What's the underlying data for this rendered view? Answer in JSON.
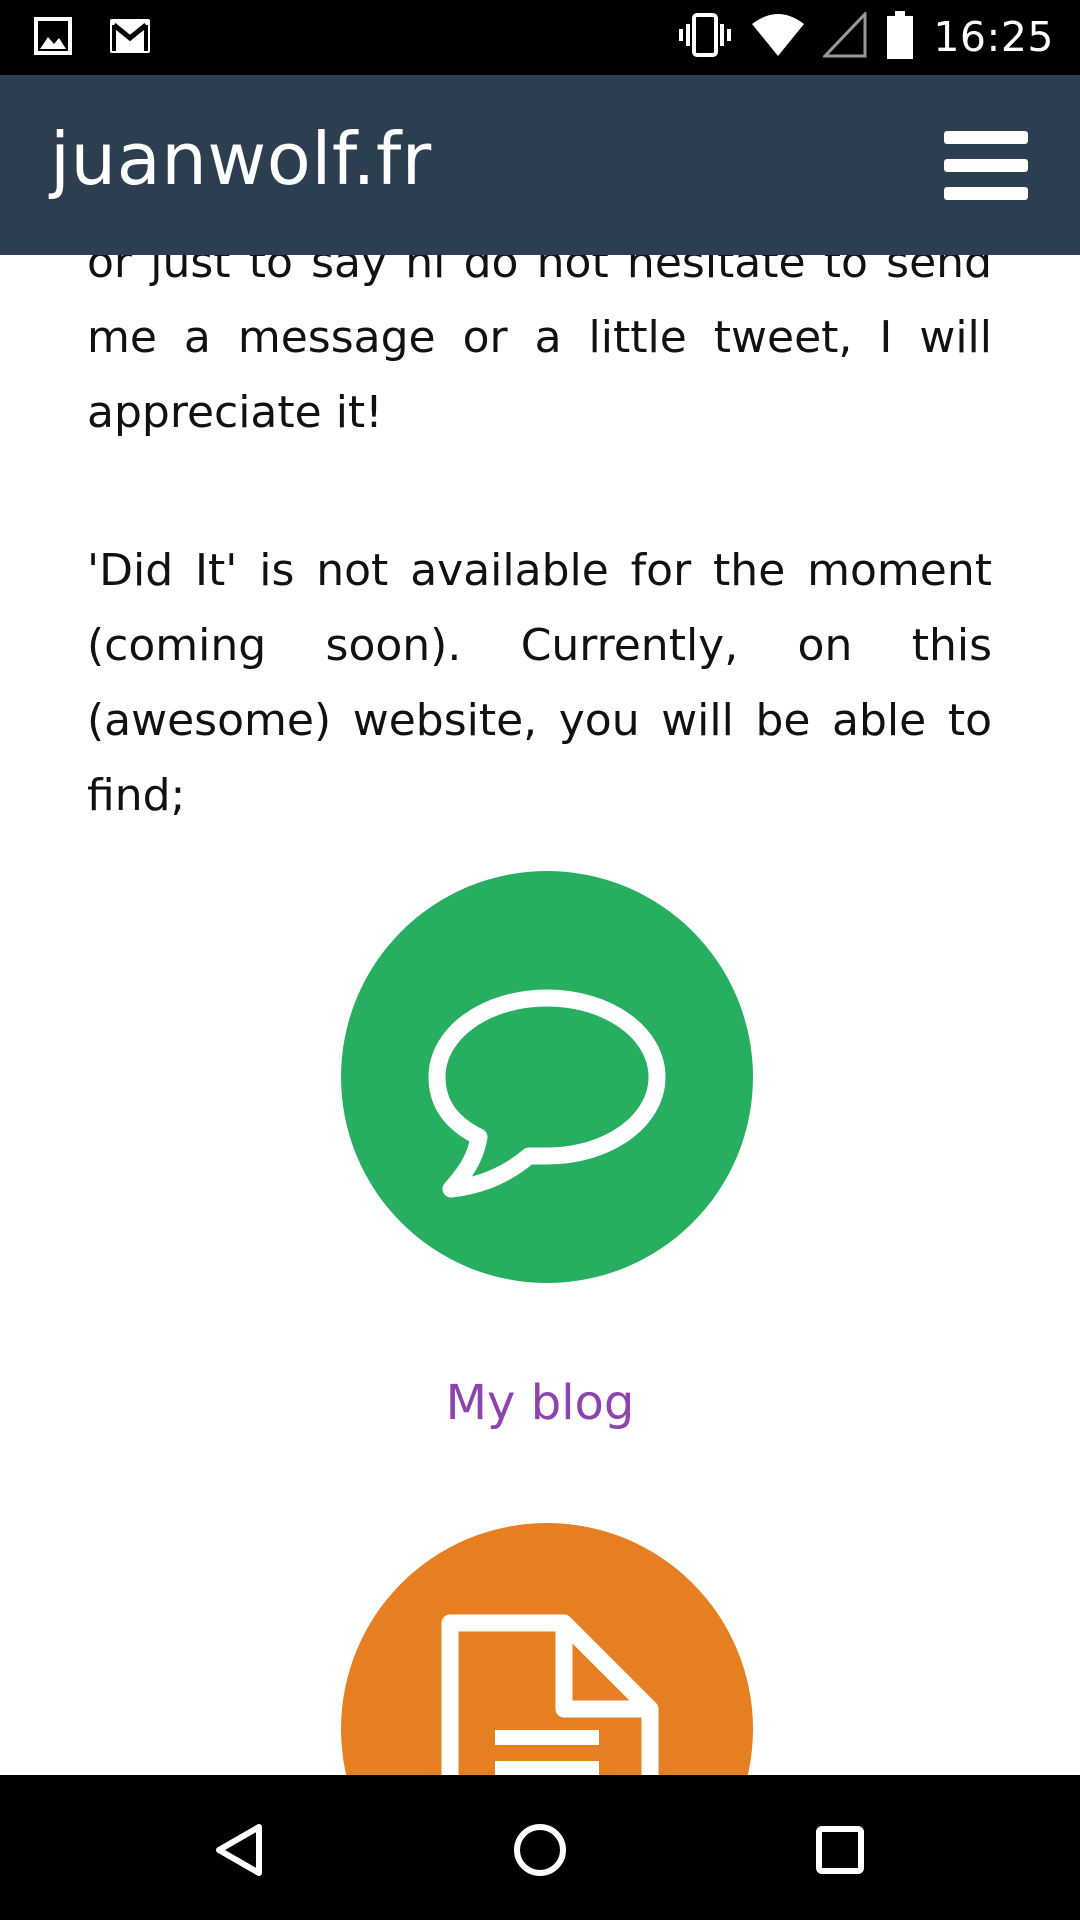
{
  "status_bar": {
    "time": "16:25",
    "left_icons": [
      "image-icon",
      "gmail-icon"
    ],
    "right_icons": [
      "vibrate-icon",
      "wifi-icon",
      "signal-icon",
      "battery-icon"
    ]
  },
  "header": {
    "site_title": "juanwolf.fr",
    "menu_icon": "hamburger-menu-icon",
    "background_color": "#2d3e50"
  },
  "content": {
    "paragraph_1": "or just to say hi do not hesitate to send me a message or a little tweet, I will appreciate it!",
    "paragraph_2": "'Did It' is not available for the moment (coming soon). Currently, on this (awesome) website, you will be able to find;",
    "features": [
      {
        "label": "My blog",
        "icon": "speech-bubble-icon",
        "color": "#27ae60"
      },
      {
        "label": "",
        "icon": "document-icon",
        "color": "#e67e22"
      }
    ],
    "link_color": "#8e44ad"
  },
  "nav_bar": {
    "buttons": [
      "back-icon",
      "home-icon",
      "recents-icon"
    ]
  }
}
